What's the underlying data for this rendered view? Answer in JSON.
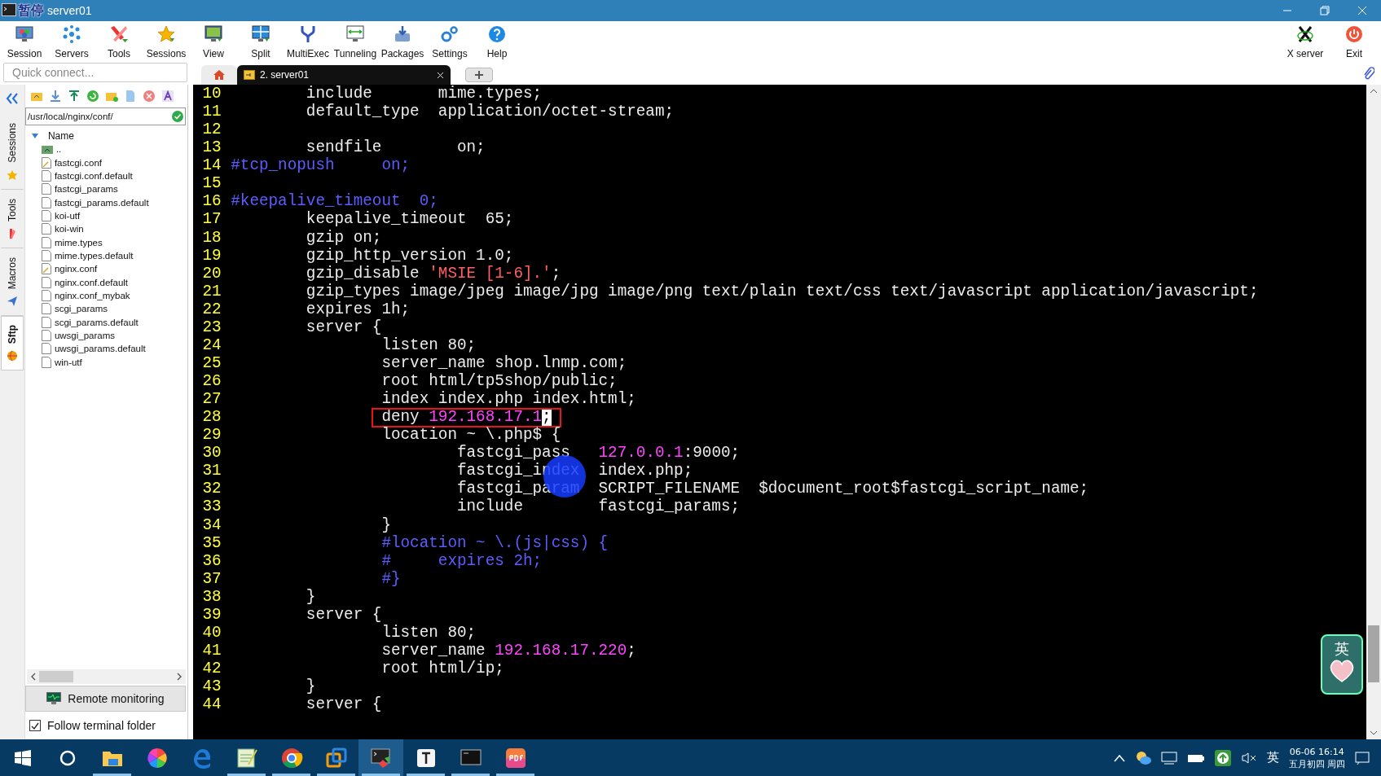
{
  "window": {
    "title": "server01",
    "overlay_label": "暂停"
  },
  "toolbar": {
    "buttons": [
      {
        "label": "Session"
      },
      {
        "label": "Servers"
      },
      {
        "label": "Tools"
      },
      {
        "label": "Sessions"
      },
      {
        "label": "View"
      },
      {
        "label": "Split"
      },
      {
        "label": "MultiExec"
      },
      {
        "label": "Tunneling"
      },
      {
        "label": "Packages"
      },
      {
        "label": "Settings"
      },
      {
        "label": "Help"
      }
    ],
    "right_buttons": [
      {
        "label": "X server"
      },
      {
        "label": "Exit"
      }
    ]
  },
  "quick_connect": {
    "placeholder": "Quick connect..."
  },
  "tabs": [
    {
      "kind": "home",
      "selected": false
    },
    {
      "kind": "session",
      "label": "2. server01",
      "selected": true
    },
    {
      "kind": "new",
      "selected": false
    }
  ],
  "side_tabs": [
    {
      "label": "Sessions",
      "selected": false
    },
    {
      "label": "Tools",
      "selected": false
    },
    {
      "label": "Macros",
      "selected": false
    },
    {
      "label": "Sftp",
      "selected": true
    }
  ],
  "sftp": {
    "path": "/usr/local/nginx/conf/",
    "column": "Name",
    "files": [
      {
        "name": "..",
        "kind": "parent"
      },
      {
        "name": "fastcgi.conf",
        "kind": "edited"
      },
      {
        "name": "fastcgi.conf.default",
        "kind": "file"
      },
      {
        "name": "fastcgi_params",
        "kind": "file"
      },
      {
        "name": "fastcgi_params.default",
        "kind": "file"
      },
      {
        "name": "koi-utf",
        "kind": "file"
      },
      {
        "name": "koi-win",
        "kind": "file"
      },
      {
        "name": "mime.types",
        "kind": "file"
      },
      {
        "name": "mime.types.default",
        "kind": "file"
      },
      {
        "name": "nginx.conf",
        "kind": "edited"
      },
      {
        "name": "nginx.conf.default",
        "kind": "file"
      },
      {
        "name": "nginx.conf_mybak",
        "kind": "file"
      },
      {
        "name": "scgi_params",
        "kind": "file"
      },
      {
        "name": "scgi_params.default",
        "kind": "file"
      },
      {
        "name": "uwsgi_params",
        "kind": "file"
      },
      {
        "name": "uwsgi_params.default",
        "kind": "file"
      },
      {
        "name": "win-utf",
        "kind": "file"
      }
    ],
    "monitor_button": "Remote monitoring",
    "follow_folder": {
      "label": "Follow terminal folder",
      "checked": true
    }
  },
  "terminal": {
    "lines": [
      {
        "number": "10",
        "boxed": false,
        "segments": [
          {
            "kind": "text",
            "text": "        include       mime.types;"
          }
        ]
      },
      {
        "number": "11",
        "boxed": false,
        "segments": [
          {
            "kind": "text",
            "text": "        default_type  application/octet-stream;"
          }
        ]
      },
      {
        "number": "12",
        "boxed": false
      },
      {
        "number": "13",
        "boxed": false,
        "segments": [
          {
            "kind": "text",
            "text": "        sendfile        on;"
          }
        ]
      },
      {
        "number": "14",
        "boxed": false,
        "segments": [
          {
            "kind": "comment",
            "text": "#tcp_nopush     on;"
          }
        ]
      },
      {
        "number": "15",
        "boxed": false
      },
      {
        "number": "16",
        "boxed": false,
        "segments": [
          {
            "kind": "comment",
            "text": "#keepalive_timeout  0;"
          }
        ]
      },
      {
        "number": "17",
        "boxed": false,
        "segments": [
          {
            "kind": "text",
            "text": "        keepalive_timeout  65;"
          }
        ]
      },
      {
        "number": "18",
        "boxed": false,
        "segments": [
          {
            "kind": "text",
            "text": "        gzip on;"
          }
        ]
      },
      {
        "number": "19",
        "boxed": false,
        "segments": [
          {
            "kind": "text",
            "text": "        gzip_http_version 1.0;"
          }
        ]
      },
      {
        "number": "20",
        "boxed": false,
        "segments": [
          {
            "kind": "text",
            "text": "        gzip_disable "
          },
          {
            "kind": "string",
            "text": "'MSIE [1-6].'"
          },
          {
            "kind": "text",
            "text": ";"
          }
        ]
      },
      {
        "number": "21",
        "boxed": false,
        "segments": [
          {
            "kind": "text",
            "text": "        gzip_types image/jpeg image/jpg image/png text/plain text/css text/javascript application/javascript;"
          }
        ]
      },
      {
        "number": "22",
        "boxed": false,
        "segments": [
          {
            "kind": "text",
            "text": "        expires 1h;"
          }
        ]
      },
      {
        "number": "23",
        "boxed": false,
        "segments": [
          {
            "kind": "text",
            "text": "        server {"
          }
        ]
      },
      {
        "number": "24",
        "boxed": false,
        "segments": [
          {
            "kind": "text",
            "text": "                listen 80;"
          }
        ]
      },
      {
        "number": "25",
        "boxed": false,
        "segments": [
          {
            "kind": "text",
            "text": "                server_name shop.lnmp.com;"
          }
        ]
      },
      {
        "number": "26",
        "boxed": false,
        "segments": [
          {
            "kind": "text",
            "text": "                root html/tp5shop/public;"
          }
        ]
      },
      {
        "number": "27",
        "boxed": false,
        "segments": [
          {
            "kind": "text",
            "text": "                index index.php index.html;"
          }
        ]
      },
      {
        "number": "28",
        "boxed": true,
        "segments": [
          {
            "kind": "text",
            "text": "                deny "
          },
          {
            "kind": "number",
            "text": "192.168.17.1"
          },
          {
            "kind": "cursor",
            "text": ";"
          }
        ]
      },
      {
        "number": "29",
        "boxed": false,
        "segments": [
          {
            "kind": "text",
            "text": "                location ~ \\.php$ {"
          }
        ]
      },
      {
        "number": "30",
        "boxed": false,
        "segments": [
          {
            "kind": "text",
            "text": "                        fastcgi_pass   "
          },
          {
            "kind": "number",
            "text": "127.0.0.1"
          },
          {
            "kind": "text",
            "text": ":9000;"
          }
        ]
      },
      {
        "number": "31",
        "boxed": false,
        "segments": [
          {
            "kind": "text",
            "text": "                        fastcgi_index  index.php;"
          }
        ]
      },
      {
        "number": "32",
        "boxed": false,
        "segments": [
          {
            "kind": "text",
            "text": "                        fastcgi_param  SCRIPT_FILENAME  $document_root$fastcgi_script_name;"
          }
        ]
      },
      {
        "number": "33",
        "boxed": false,
        "segments": [
          {
            "kind": "text",
            "text": "                        include        fastcgi_params;"
          }
        ]
      },
      {
        "number": "34",
        "boxed": false,
        "segments": [
          {
            "kind": "text",
            "text": "                }"
          }
        ]
      },
      {
        "number": "35",
        "boxed": false,
        "segments": [
          {
            "kind": "comment",
            "text": "                #location ~ \\.(js|css) {"
          }
        ]
      },
      {
        "number": "36",
        "boxed": false,
        "segments": [
          {
            "kind": "comment",
            "text": "                #     expires 2h;"
          }
        ]
      },
      {
        "number": "37",
        "boxed": false,
        "segments": [
          {
            "kind": "comment",
            "text": "                #}"
          }
        ]
      },
      {
        "number": "38",
        "boxed": false,
        "segments": [
          {
            "kind": "text",
            "text": "        }"
          }
        ]
      },
      {
        "number": "39",
        "boxed": false,
        "segments": [
          {
            "kind": "text",
            "text": "        server {"
          }
        ]
      },
      {
        "number": "40",
        "boxed": false,
        "segments": [
          {
            "kind": "text",
            "text": "                listen 80;"
          }
        ]
      },
      {
        "number": "41",
        "boxed": false,
        "segments": [
          {
            "kind": "text",
            "text": "                server_name "
          },
          {
            "kind": "number",
            "text": "192.168.17.220"
          },
          {
            "kind": "text",
            "text": ";"
          }
        ]
      },
      {
        "number": "42",
        "boxed": false,
        "segments": [
          {
            "kind": "text",
            "text": "                root html/ip;"
          }
        ]
      },
      {
        "number": "43",
        "boxed": false,
        "segments": [
          {
            "kind": "text",
            "text": "        }"
          }
        ]
      },
      {
        "number": "44",
        "boxed": false,
        "segments": [
          {
            "kind": "text",
            "text": "        server {"
          }
        ]
      }
    ]
  },
  "ime_widget": {
    "label": "英"
  },
  "taskbar": {
    "apps": [
      {
        "running": true,
        "selected": false
      },
      {
        "running": false,
        "selected": false
      },
      {
        "running": false,
        "selected": false
      },
      {
        "running": true,
        "selected": false
      },
      {
        "running": true,
        "selected": false
      },
      {
        "running": true,
        "selected": false
      },
      {
        "running": true,
        "selected": true
      },
      {
        "running": true,
        "selected": false
      },
      {
        "running": true,
        "selected": false
      },
      {
        "running": true,
        "selected": false
      }
    ]
  },
  "tray": {
    "ime": "英",
    "time": "06-06 16:14",
    "date": "五月初四 周四"
  }
}
